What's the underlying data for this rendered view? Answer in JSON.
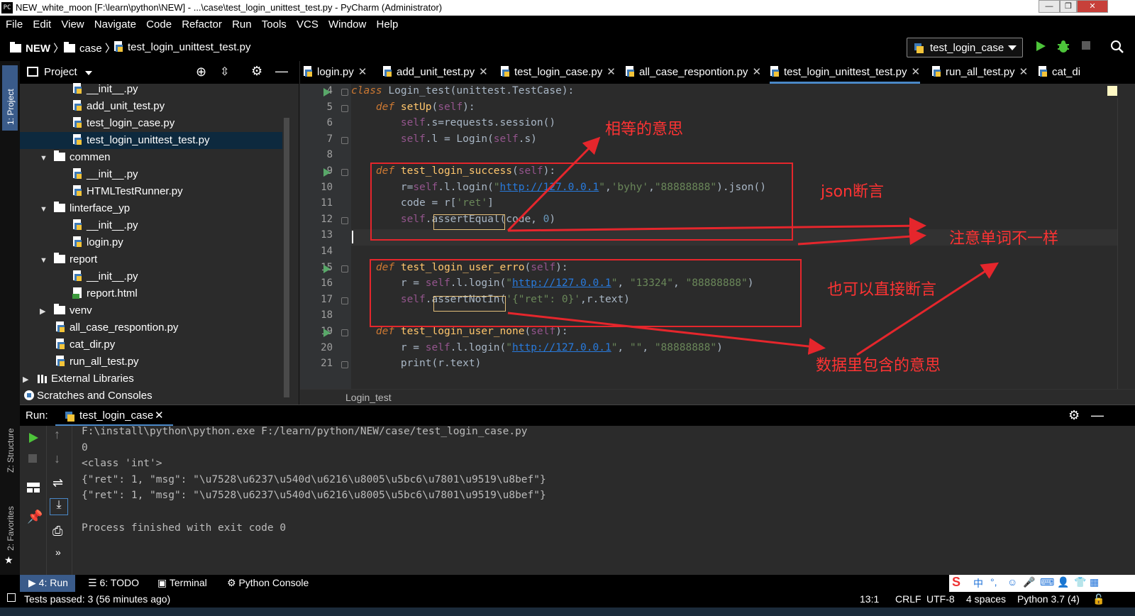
{
  "window": {
    "title": "NEW_white_moon [F:\\learn\\python\\NEW] - ...\\case\\test_login_unittest_test.py - PyCharm (Administrator)",
    "app_icon_text": "PC"
  },
  "menu": [
    "File",
    "Edit",
    "View",
    "Navigate",
    "Code",
    "Refactor",
    "Run",
    "Tools",
    "VCS",
    "Window",
    "Help"
  ],
  "breadcrumb": {
    "project": "NEW",
    "folder": "case",
    "file": "test_login_unittest_test.py"
  },
  "run_config": {
    "selected": "test_login_case"
  },
  "left_strip": {
    "project": "1: Project",
    "structure": "Z: Structure",
    "favorites": "2: Favorites"
  },
  "project_panel": {
    "title": "Project",
    "tree": [
      {
        "label": "__init__.py",
        "type": "py",
        "indent": 3
      },
      {
        "label": "add_unit_test.py",
        "type": "py",
        "indent": 3
      },
      {
        "label": "test_login_case.py",
        "type": "py",
        "indent": 3
      },
      {
        "label": "test_login_unittest_test.py",
        "type": "py",
        "indent": 3,
        "selected": true
      },
      {
        "label": "commen",
        "type": "folder",
        "indent": 1,
        "expanded": true
      },
      {
        "label": "__init__.py",
        "type": "py",
        "indent": 3
      },
      {
        "label": "HTMLTestRunner.py",
        "type": "py",
        "indent": 3
      },
      {
        "label": "linterface_yp",
        "type": "folder",
        "indent": 1,
        "expanded": true
      },
      {
        "label": "__init__.py",
        "type": "py",
        "indent": 3
      },
      {
        "label": "login.py",
        "type": "py",
        "indent": 3
      },
      {
        "label": "report",
        "type": "folder",
        "indent": 1,
        "expanded": true
      },
      {
        "label": "__init__.py",
        "type": "py",
        "indent": 3
      },
      {
        "label": "report.html",
        "type": "html",
        "indent": 3
      },
      {
        "label": "venv",
        "type": "folder",
        "indent": 1,
        "expanded": false
      },
      {
        "label": "all_case_respontion.py",
        "type": "py",
        "indent": 2
      },
      {
        "label": "cat_dir.py",
        "type": "py",
        "indent": 2
      },
      {
        "label": "run_all_test.py",
        "type": "py",
        "indent": 2
      },
      {
        "label": "External Libraries",
        "type": "lib",
        "indent": 0,
        "expanded": false
      },
      {
        "label": "Scratches and Consoles",
        "type": "scratch",
        "indent": 0
      }
    ]
  },
  "editor_tabs": [
    {
      "label": "login.py"
    },
    {
      "label": "add_unit_test.py"
    },
    {
      "label": "test_login_case.py"
    },
    {
      "label": "all_case_respontion.py"
    },
    {
      "label": "test_login_unittest_test.py",
      "active": true
    },
    {
      "label": "run_all_test.py"
    },
    {
      "label": "cat_di"
    }
  ],
  "code_lines": [
    {
      "n": "4",
      "html": "<span class=\"kw\">class</span> Login_test(unittest.TestCase):"
    },
    {
      "n": "5",
      "html": "    <span class=\"kw\">def</span> <span class=\"fn\">setUp</span>(<span class=\"self\">self</span>):"
    },
    {
      "n": "6",
      "html": "        <span class=\"self\">self</span>.s=requests.session()"
    },
    {
      "n": "7",
      "html": "        <span class=\"self\">self</span>.l = Login(<span class=\"self\">self</span>.s)"
    },
    {
      "n": "8",
      "html": ""
    },
    {
      "n": "9",
      "html": "    <span class=\"kw\">def</span> <span class=\"fn\">test_login_success</span>(<span class=\"self\">self</span>):"
    },
    {
      "n": "10",
      "html": "        r=<span class=\"self\">self</span>.l.login(<span class=\"str\">\"<span class=\"url\">http://127.0.0.1</span>\"</span>,<span class=\"str\">'byhy'</span>,<span class=\"str\">\"88888888\"</span>).json()"
    },
    {
      "n": "11",
      "html": "        code = r[<span class=\"str\">'ret'</span>]"
    },
    {
      "n": "12",
      "html": "        <span class=\"self\">self</span>.assertEqual(code, <span class=\"num\">0</span>)"
    },
    {
      "n": "13",
      "html": ""
    },
    {
      "n": "14",
      "html": ""
    },
    {
      "n": "15",
      "html": "    <span class=\"kw\">def</span> <span class=\"fn\">test_login_user_erro</span>(<span class=\"self\">self</span>):"
    },
    {
      "n": "16",
      "html": "        r = <span class=\"self\">self</span>.l.login(<span class=\"str\">\"<span class=\"url\">http://127.0.0.1</span>\"</span>, <span class=\"str\">\"13324\"</span>, <span class=\"str\">\"88888888\"</span>)"
    },
    {
      "n": "17",
      "html": "        <span class=\"self\">self</span>.assertNotIn(<span class=\"str\">'{\"ret\": 0}'</span>,r.text)"
    },
    {
      "n": "18",
      "html": ""
    },
    {
      "n": "19",
      "html": "    <span class=\"kw\">def</span> <span class=\"fn\">test_login_user_none</span>(<span class=\"self\">self</span>):"
    },
    {
      "n": "20",
      "html": "        r = <span class=\"self\">self</span>.l.login(<span class=\"str\">\"<span class=\"url\">http://127.0.0.1</span>\"</span>, <span class=\"str\">\"\"</span>, <span class=\"str\">\"88888888\"</span>)"
    },
    {
      "n": "21",
      "html": "        print(r.text)"
    }
  ],
  "editor_breadcrumb": "Login_test",
  "run_panel": {
    "label": "Run:",
    "tab": "test_login_case"
  },
  "console_lines": [
    "F:\\install\\python\\python.exe F:/learn/python/NEW/case/test_login_case.py",
    "0",
    "<class 'int'>",
    "{\"ret\": 1, \"msg\": \"\\u7528\\u6237\\u540d\\u6216\\u8005\\u5bc6\\u7801\\u9519\\u8bef\"}",
    "{\"ret\": 1, \"msg\": \"\\u7528\\u6237\\u540d\\u6216\\u8005\\u5bc6\\u7801\\u9519\\u8bef\"}",
    "",
    "Process finished with exit code 0"
  ],
  "bottom_tabs": {
    "run": "4: Run",
    "todo": "6: TODO",
    "terminal": "Terminal",
    "python_console": "Python Console"
  },
  "status": {
    "message": "Tests passed: 3 (56 minutes ago)",
    "position": "13:1",
    "line_sep": "CRLF",
    "encoding": "UTF-8",
    "indent": "4 spaces",
    "interpreter": "Python 3.7 (4)"
  },
  "annotations": {
    "equal": "相等的意思",
    "json": "json断言",
    "word": "注意单词不一样",
    "direct": "也可以直接断言",
    "contains": "数据里包含的意思"
  },
  "ime": {
    "lang": "中"
  },
  "colors": {
    "annotation": "#ff3333",
    "accent": "#4a88c7",
    "run_green": "#59a869"
  }
}
